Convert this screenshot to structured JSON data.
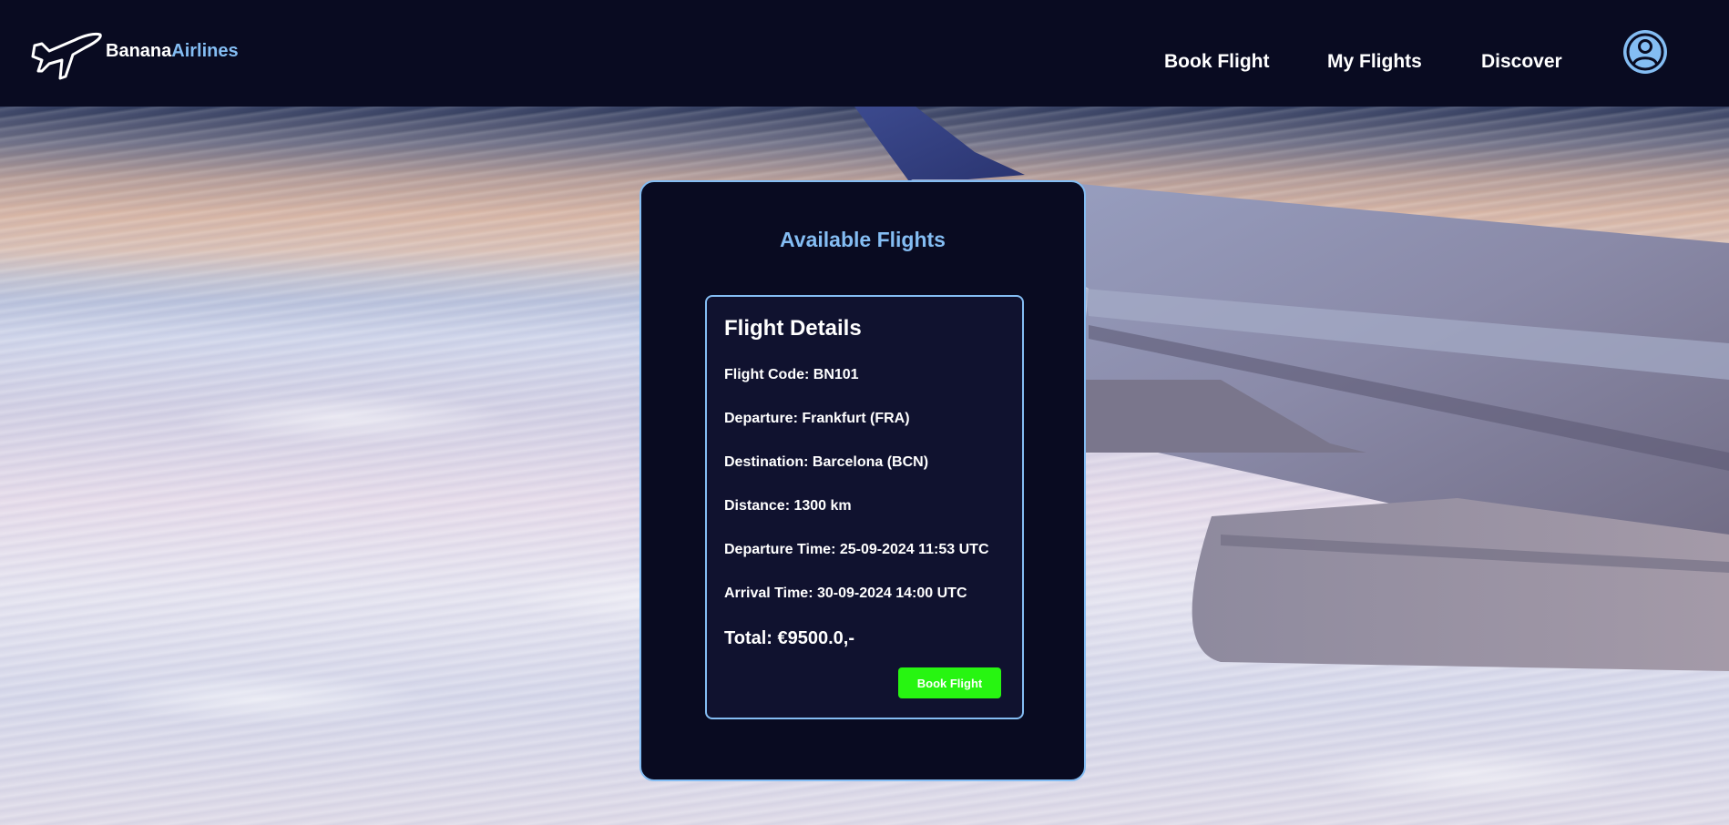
{
  "brand": {
    "name_part1": "Banana",
    "name_part2": "Airlines",
    "logo_icon": "airplane-icon"
  },
  "nav": {
    "items": [
      {
        "label": "Book Flight"
      },
      {
        "label": "My Flights"
      },
      {
        "label": "Discover"
      }
    ],
    "profile_icon": "user-circle-icon"
  },
  "main": {
    "title": "Available Flights",
    "flight": {
      "heading": "Flight Details",
      "code": "Flight Code: BN101",
      "departure": "Departure: Frankfurt (FRA)",
      "destination": "Destination: Barcelona (BCN)",
      "distance": "Distance: 1300 km",
      "departure_time": "Departure Time: 25-09-2024 11:53 UTC",
      "arrival_time": "Arrival Time: 30-09-2024 14:00 UTC",
      "total": "Total: €9500.0,-",
      "book_label": "Book Flight"
    }
  },
  "colors": {
    "navbar": "#090b21",
    "accent": "#84bdf3",
    "card": "#090b21",
    "inner_card": "#10122f",
    "book_button": "#27f511"
  }
}
